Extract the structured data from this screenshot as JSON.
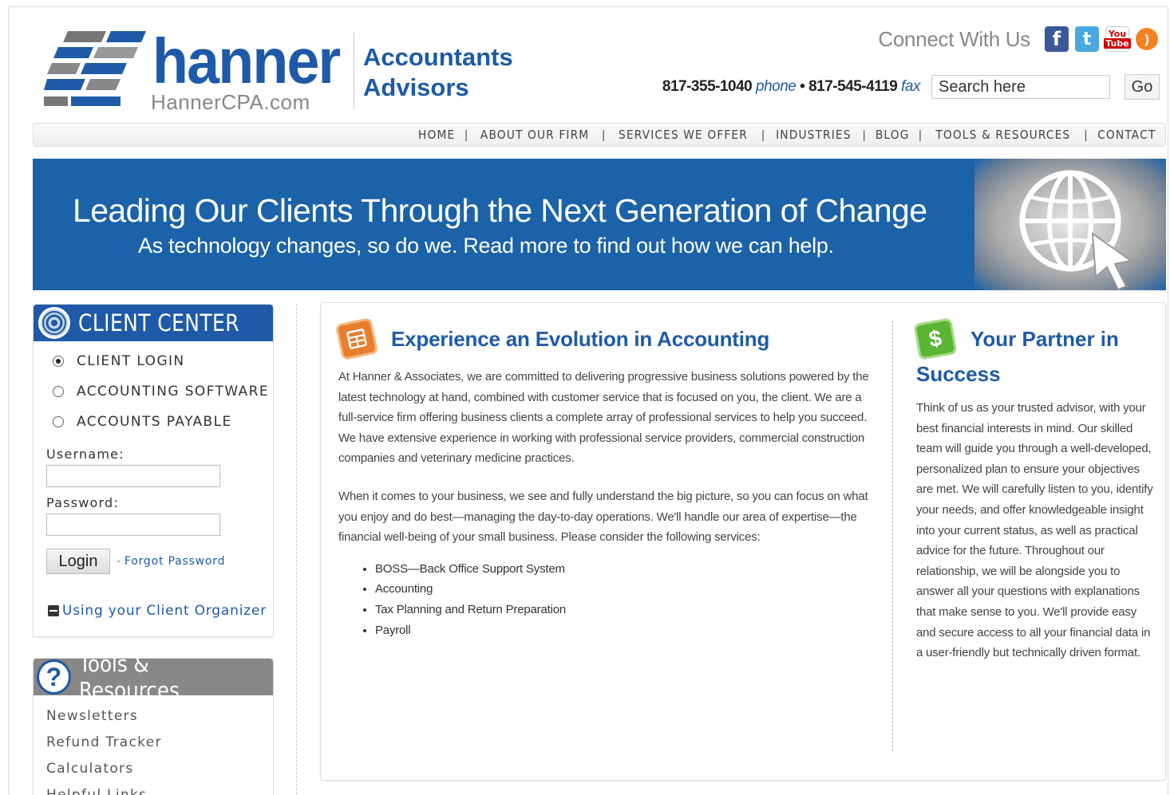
{
  "header": {
    "logo_name": "hanner",
    "logo_domain": "HannerCPA.com",
    "tagline_1": "Accountants",
    "tagline_2": "Advisors",
    "connect_label": "Connect With Us",
    "social": {
      "facebook": "f",
      "twitter": "t",
      "youtube_top": "You",
      "youtube_bottom": "Tube",
      "rss": ")"
    },
    "phone": "817-355-1040",
    "phone_label": "phone",
    "fax": "817-545-4119",
    "fax_label": "fax",
    "bullet": "•",
    "search_placeholder": "Search here",
    "go_label": "Go"
  },
  "nav": {
    "items": [
      "HOME",
      "ABOUT OUR FIRM",
      "SERVICES WE OFFER",
      "INDUSTRIES",
      "BLOG",
      "TOOLS & RESOURCES",
      "CONTACT"
    ],
    "separator": "|"
  },
  "banner": {
    "title": "Leading Our Clients Through the Next Generation of Change",
    "subtitle": "As technology changes, so do we. Read more to find out how we can help."
  },
  "client_center": {
    "title": "CLIENT CENTER",
    "options": [
      "CLIENT LOGIN",
      "ACCOUNTING SOFTWARE",
      "ACCOUNTS PAYABLE"
    ],
    "username_label": "Username:",
    "password_label": "Password:",
    "login_label": "Login",
    "forgot_dash": "-",
    "forgot_label": "Forgot Password",
    "organizer_label": "Using your Client Organizer"
  },
  "tools": {
    "title": "Tools & Resources",
    "icon_glyph": "?",
    "items": [
      "Newsletters",
      "Refund Tracker",
      "Calculators",
      "Helpful Links"
    ]
  },
  "main": {
    "heading": "Experience an Evolution in Accounting",
    "para1": "At Hanner & Associates, we are committed to delivering progressive business solutions powered by the latest technology at hand, combined with customer service that is focused on you, the client. We are a full-service firm offering business clients a complete array of professional services to help you succeed. We have extensive experience in working with professional service providers, commercial construction companies and veterinary medicine practices.",
    "para2": "When it comes to your business, we see and fully understand the big picture, so you can focus on what you enjoy and do best—managing the day-to-day operations. We'll handle our area of expertise—the financial well-being of your small business. Please consider the following services:",
    "services": [
      "BOSS—Back Office Support System",
      "Accounting",
      "Tax Planning and Return Preparation",
      "Payroll"
    ]
  },
  "partner": {
    "heading_1": "Your Partner in",
    "heading_2": "Success",
    "dollar": "$",
    "para": "Think of us as your trusted advisor, with your best financial interests in mind. Our skilled team will guide you through a well-developed, personalized plan to ensure your objectives are met. We will carefully listen to you, identify your needs, and offer knowledgeable insight into your current status, as well as practical advice for the future. Throughout our relationship, we will be alongside you to answer all your questions with explanations that make sense to you. We'll provide easy and secure access to all your financial data in a user-friendly but technically driven format."
  },
  "colors": {
    "brand_blue": "#1e5aa8",
    "banner_blue": "#1b62a8",
    "tools_gray": "#888888",
    "calc_orange": "#e87d2e",
    "dollar_green": "#5bb534"
  }
}
